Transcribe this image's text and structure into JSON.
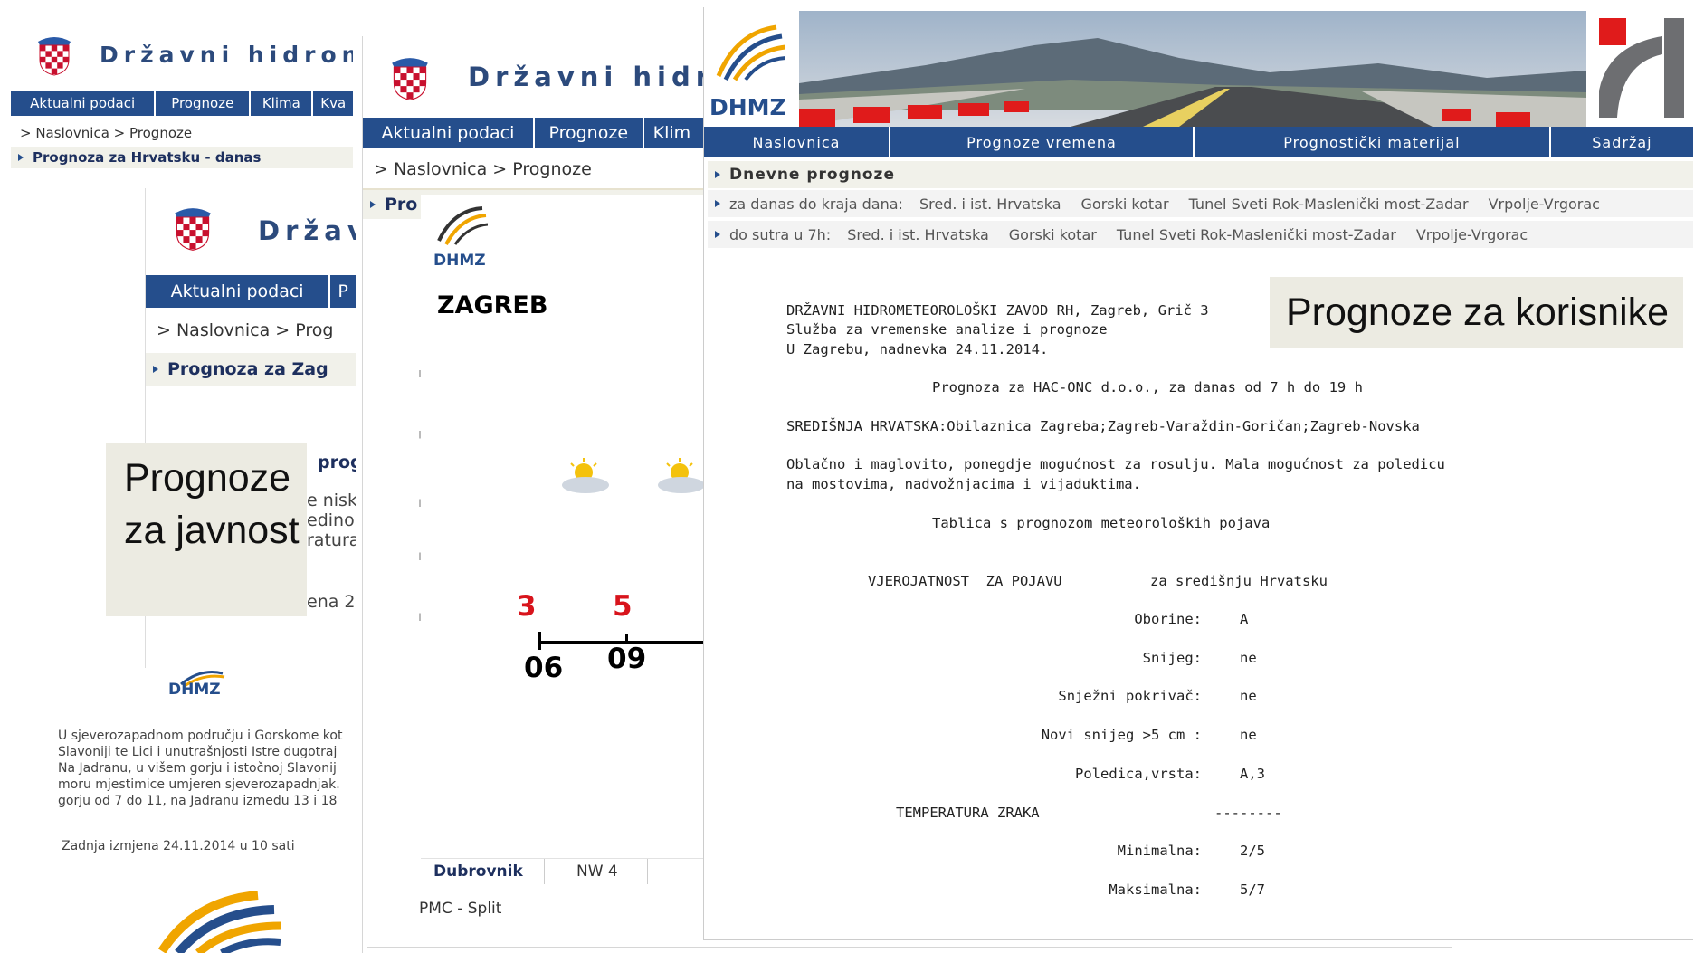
{
  "panel1": {
    "site_title": "Državni hidrome",
    "nav": [
      "Aktualni podaci",
      "Prognoze",
      "Klima",
      "Kva"
    ],
    "breadcrumb": "> Naslovnica > Prognoze",
    "section": "Prognoza za Hrvatsku - danas",
    "footer_logo": "DHMZ",
    "text_lines": [
      "U sjeverozapadnom području i Gorskome kot",
      "Slavoniji te Lici i unutrašnjosti Istre dugotraj",
      "Na Jadranu, u višem gorju i istočnoj Slavonij",
      "moru mjestimice umjeren sjeverozapadnjak.",
      "gorju od 7 do 11, na Jadranu između 13 i 18"
    ],
    "last_change": "Zadnja izmjena 24.11.2014 u 10 sati"
  },
  "panel1b": {
    "site_title": "Držav",
    "nav": [
      "Aktualni podaci",
      "P"
    ],
    "breadcrumb": "> Naslovnica > Prog",
    "section": "Prognoza za Zag",
    "fragments": [
      "prog",
      "e nisk",
      "edino",
      "ratura",
      "ena 2"
    ]
  },
  "panel2": {
    "site_title": "Državni hidr",
    "nav": [
      "Aktualni podaci",
      "Prognoze",
      "Klim"
    ],
    "breadcrumb": "> Naslovnica > Prognoze",
    "section": "Pro",
    "logo": "DHMZ",
    "city": "ZAGREB",
    "temps": [
      "3",
      "5"
    ],
    "hours": [
      "06",
      "09"
    ],
    "table_city": "Dubrovnik",
    "table_wind": "NW 4",
    "pmc": "PMC - Split"
  },
  "callout_public": "Prognoze za javnost",
  "callout_users": "Prognoze za korisnike",
  "panel3": {
    "logo": "DHMZ",
    "nav": [
      "Naslovnica",
      "Prognoze vremena",
      "Prognostički materijal",
      "Sadržaj"
    ],
    "section": "Dnevne prognoze",
    "row1_label": "za danas do kraja dana:",
    "row2_label": "do sutra u 7h:",
    "links": [
      "Sred. i ist. Hrvatska",
      "Gorski kotar",
      "Tunel Sveti Rok-Maslenički most-Zadar",
      "Vrpolje-Vrgorac"
    ],
    "header_lines": [
      "DRŽAVNI HIDROMETEOROLOŠKI ZAVOD RH, Zagreb, Grič 3",
      "Služba za vremenske analize i prognoze",
      "U Zagrebu, nadnevka 24.11.2014."
    ],
    "forecast_title": "Prognoza za HAC-ONC d.o.o., za danas od 7 h do 19 h",
    "region": "SREDIŠNJA HRVATSKA:Obilaznica Zagreba;Zagreb-Varaždin-Goričan;Zagreb-Novska",
    "desc_lines": [
      "Oblačno i maglovito, ponegdje mogućnost za rosulju. Mala mogućnost za poledicu",
      "na mostovima, nadvožnjacima i vijaduktima."
    ],
    "table_title": "Tablica s prognozom meteoroloških pojava",
    "prob_label": "VJEROJATNOST  ZA POJAVU",
    "prob_scope": "za središnju Hrvatsku",
    "rows": [
      {
        "label": "Oborine:",
        "value": "A"
      },
      {
        "label": "Snijeg:",
        "value": "ne"
      },
      {
        "label": "Snježni pokrivač:",
        "value": "ne"
      },
      {
        "label": "Novi snijeg >5 cm :",
        "value": "ne"
      },
      {
        "label": "Poledica,vrsta:",
        "value": "A,3"
      }
    ],
    "temp_label": "TEMPERATURA ZRAKA",
    "temp_dash": "--------",
    "temp_rows": [
      {
        "label": "Minimalna:",
        "value": "2/5"
      },
      {
        "label": "Maksimalna:",
        "value": "5/7"
      }
    ]
  }
}
